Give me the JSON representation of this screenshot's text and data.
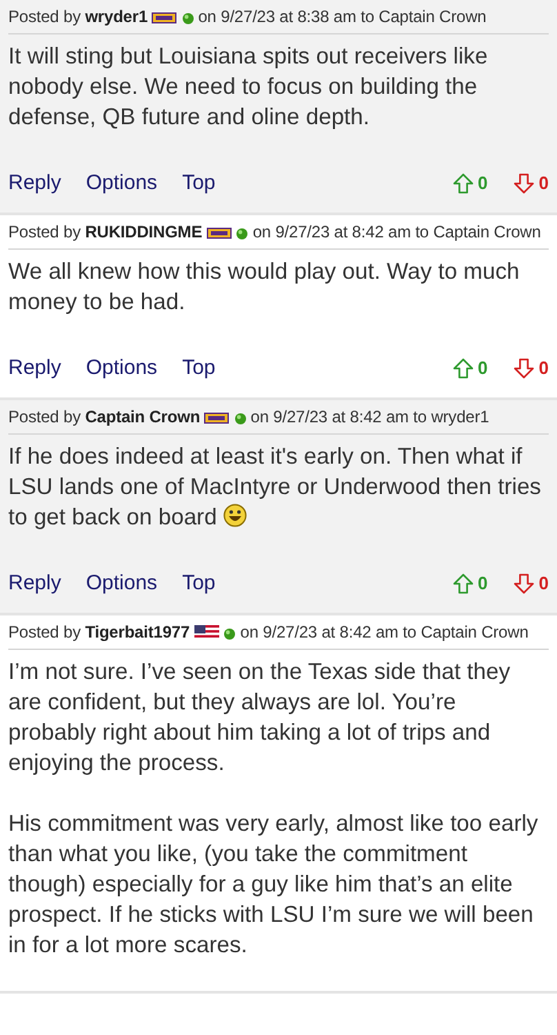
{
  "posts": [
    {
      "posted_by_label": "Posted by",
      "author": "wryder1",
      "flair": {
        "kind": "team"
      },
      "online": true,
      "meta": "on 9/27/23 at 8:38 am to Captain Crown",
      "paragraphs": [
        "It will sting but Louisiana spits out receivers like nobody else. We need to focus on building the defense, QB future and oline depth."
      ],
      "actions": [
        "Reply",
        "Options",
        "Top"
      ],
      "upvotes": "0",
      "downvotes": "0"
    },
    {
      "posted_by_label": "Posted by",
      "author": "RUKIDDINGME",
      "flair": {
        "kind": "team"
      },
      "online": true,
      "meta": "on 9/27/23 at 8:42 am to Captain Crown",
      "paragraphs": [
        "We all knew how this would play out. Way to much money to be had."
      ],
      "actions": [
        "Reply",
        "Options",
        "Top"
      ],
      "upvotes": "0",
      "downvotes": "0"
    },
    {
      "posted_by_label": "Posted by",
      "author": "Captain Crown",
      "flair": {
        "kind": "team"
      },
      "online": true,
      "meta": "on 9/27/23 at 8:42 am to wryder1",
      "paragraphs": [
        "If he does indeed at least it's early on. Then what if LSU lands one of MacIntyre or Underwood then tries to get back on board"
      ],
      "emoji": true,
      "actions": [
        "Reply",
        "Options",
        "Top"
      ],
      "upvotes": "0",
      "downvotes": "0"
    },
    {
      "posted_by_label": "Posted by",
      "author": "Tigerbait1977",
      "flair": {
        "kind": "flag"
      },
      "online": true,
      "meta": "on 9/27/23 at 8:42 am to Captain Crown",
      "paragraphs": [
        "I’m not sure. I’ve seen on the Texas side that they are confident, but they always are lol. You’re probably right about him taking a lot of trips and enjoying the process.",
        "His commitment was very early, almost like too early than what you like, (you take the commitment though) especially for a guy like him that’s an elite prospect. If he sticks with LSU I’m sure we will been in for a lot more scares."
      ]
    }
  ]
}
